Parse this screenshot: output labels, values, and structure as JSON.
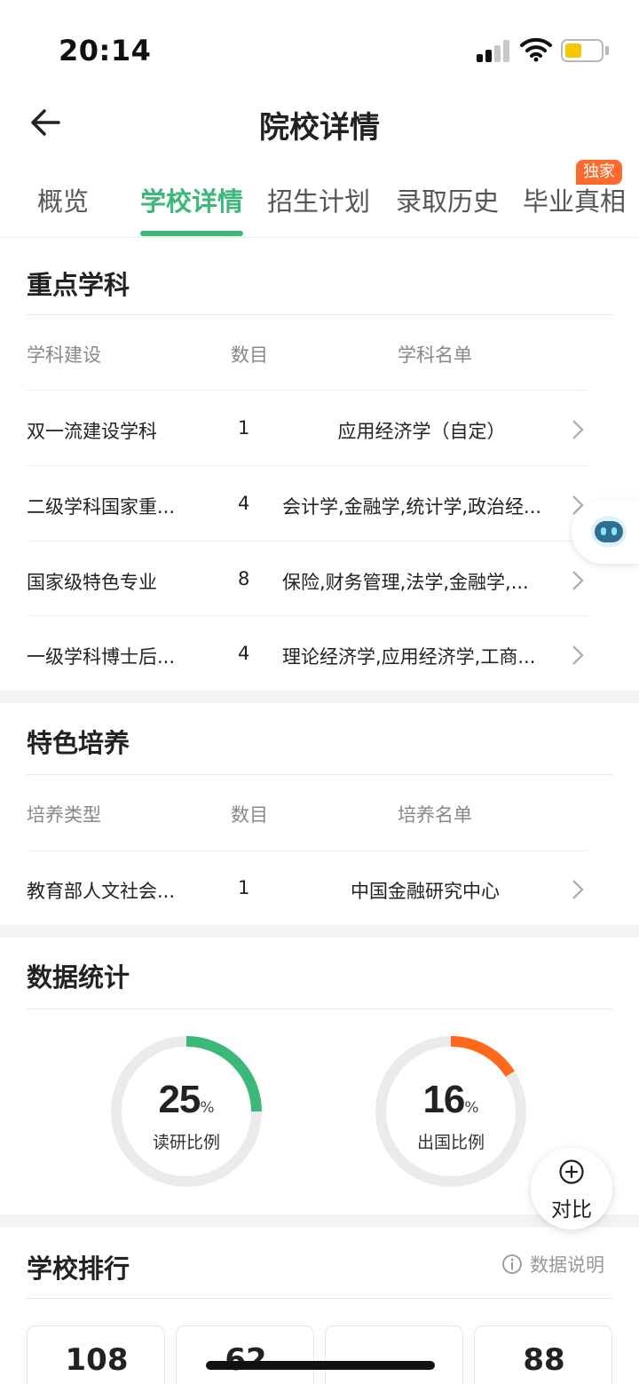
{
  "status_bar": {
    "time": "20:14"
  },
  "header": {
    "title": "院校详情"
  },
  "tabs": [
    {
      "label": "概览"
    },
    {
      "label": "学校详情",
      "active": true
    },
    {
      "label": "招生计划"
    },
    {
      "label": "录取历史"
    },
    {
      "label": "毕业真相",
      "badge": "独家"
    }
  ],
  "key_disciplines": {
    "title": "重点学科",
    "columns": [
      "学科建设",
      "数目",
      "学科名单"
    ],
    "rows": [
      {
        "type": "双一流建设学科",
        "count": "1",
        "list": "应用经济学（自定）"
      },
      {
        "type": "二级学科国家重...",
        "count": "4",
        "list": "会计学,金融学,统计学,政治经..."
      },
      {
        "type": "国家级特色专业",
        "count": "8",
        "list": "保险,财务管理,法学,金融学,..."
      },
      {
        "type": "一级学科博士后...",
        "count": "4",
        "list": "理论经济学,应用经济学,工商..."
      }
    ]
  },
  "special_training": {
    "title": "特色培养",
    "columns": [
      "培养类型",
      "数目",
      "培养名单"
    ],
    "rows": [
      {
        "type": "教育部人文社会...",
        "count": "1",
        "list": "中国金融研究中心"
      }
    ]
  },
  "statistics": {
    "title": "数据统计",
    "items": [
      {
        "value": "25",
        "unit": "%",
        "label": "读研比例",
        "fraction": 0.25,
        "color": "#3cb878"
      },
      {
        "value": "16",
        "unit": "%",
        "label": "出国比例",
        "fraction": 0.16,
        "color": "#ff6a1a"
      }
    ]
  },
  "ranking": {
    "title": "学校排行",
    "data_note": "数据说明",
    "values": [
      "108",
      "62",
      "",
      "88"
    ]
  },
  "compare_button": {
    "label": "对比"
  },
  "colors": {
    "accent": "#3cb878",
    "orange": "#ff6a1a",
    "badge": "#ff6a2c"
  }
}
